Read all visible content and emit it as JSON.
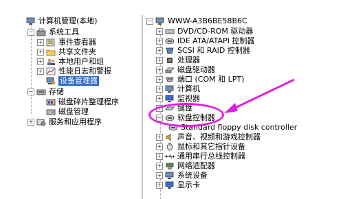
{
  "left_tree": {
    "root": "计算机管理(本地)",
    "system_tools": "系统工具",
    "event_viewer": "事件查看器",
    "shared_folders": "共享文件夹",
    "local_users": "本地用户和组",
    "perf_logs": "性能日志和警报",
    "device_manager": "设备管理器",
    "storage": "存储",
    "defrag": "磁盘碎片整理程序",
    "disk_mgmt": "磁盘管理",
    "services_apps": "服务和应用程序"
  },
  "right_tree": {
    "computer_name": "WWW-A3B6BE58B6C",
    "items": [
      "DVD/CD-ROM 驱动器",
      "IDE ATA/ATAPI 控制器",
      "SCSI 和 RAID 控制器",
      "处理器",
      "磁盘驱动器",
      "端口 (COM 和 LPT)",
      "计算机",
      "监视器",
      "键盘",
      "软盘控制器",
      "Standard floppy disk controller",
      "声音、视频和游戏控制器",
      "鼠标和其它指针设备",
      "通用串行总线控制器",
      "网络适配器",
      "系统设备",
      "显示卡"
    ]
  },
  "colors": {
    "highlight": "#e21ee0",
    "selection": "#316ac5"
  }
}
